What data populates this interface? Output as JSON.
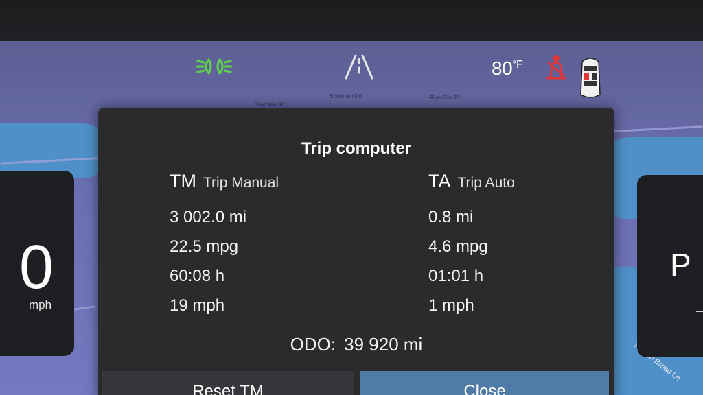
{
  "status_bar": {
    "temperature_value": "80",
    "temperature_unit": "°F",
    "icons": [
      "headlights-icon",
      "lane-assist-icon",
      "seatbelt-warning-icon",
      "car-door-status-icon"
    ],
    "colors": {
      "headlights": "#5fd34a",
      "seatbelt": "#e0383a"
    }
  },
  "map": {
    "streets": [
      "Shortham Rd",
      "Shortham Rd",
      "River Bim Rd",
      "French Broad Ln"
    ]
  },
  "speed": {
    "value": "0",
    "unit": "mph"
  },
  "gear": {
    "value": "P"
  },
  "trip_computer": {
    "title": "Trip computer",
    "tm": {
      "abbr": "TM",
      "name": "Trip Manual",
      "distance": "3 002.0 mi",
      "economy": "22.5 mpg",
      "time": "60:08 h",
      "avg_speed": "19 mph"
    },
    "ta": {
      "abbr": "TA",
      "name": "Trip Auto",
      "distance": "0.8 mi",
      "economy": "4.6 mpg",
      "time": "01:01 h",
      "avg_speed": "1 mph"
    },
    "odo_label": "ODO:",
    "odo_value": "39 920 mi",
    "reset_label": "Reset TM",
    "close_label": "Close"
  }
}
